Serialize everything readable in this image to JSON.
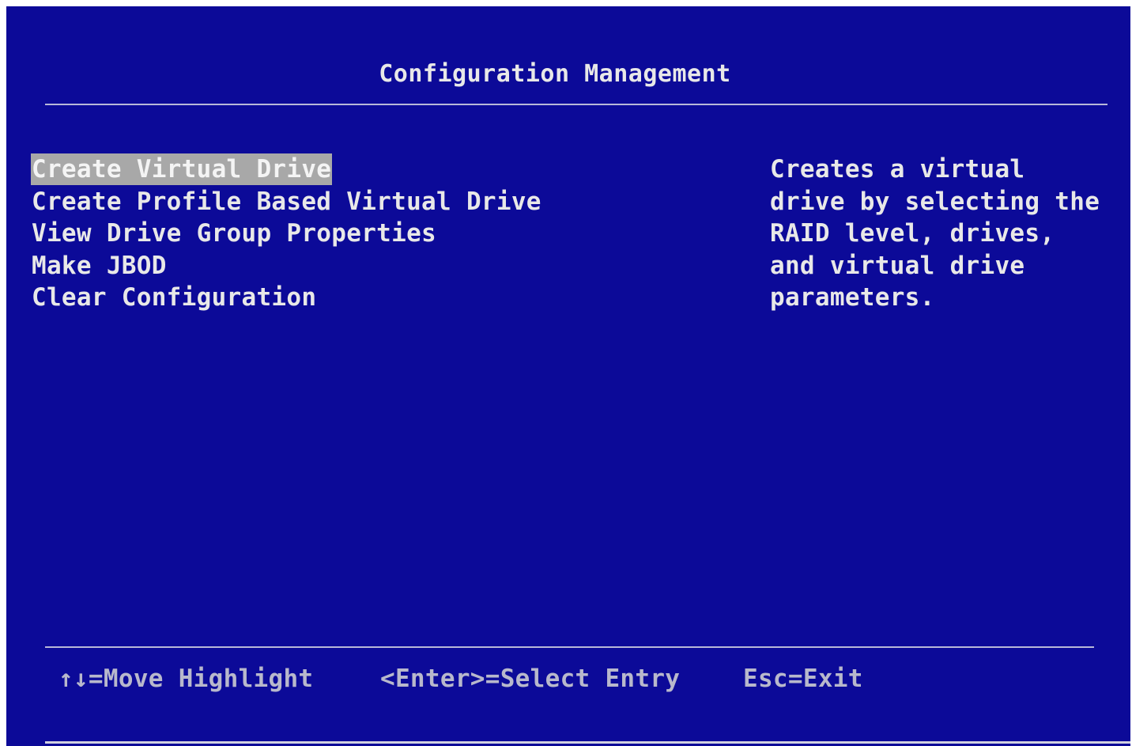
{
  "header": {
    "title": "Configuration Management"
  },
  "menu": {
    "items": [
      {
        "label": "Create Virtual Drive",
        "selected": true
      },
      {
        "label": "Create Profile Based Virtual Drive",
        "selected": false
      },
      {
        "label": "View Drive Group Properties",
        "selected": false
      },
      {
        "label": "Make JBOD",
        "selected": false
      },
      {
        "label": "Clear Configuration",
        "selected": false
      }
    ]
  },
  "help": {
    "lines": [
      "Creates a virtual",
      "drive by selecting the",
      "RAID level, drives,",
      "and virtual drive",
      "parameters."
    ]
  },
  "footer": {
    "move": "↑↓=Move Highlight",
    "enter": "<Enter>=Select Entry",
    "esc": "Esc=Exit"
  },
  "colors": {
    "background": "#0c0a98",
    "text": "#e8e8e8",
    "highlight": "#a8a8a8",
    "footer_text": "#b8b8cc"
  }
}
